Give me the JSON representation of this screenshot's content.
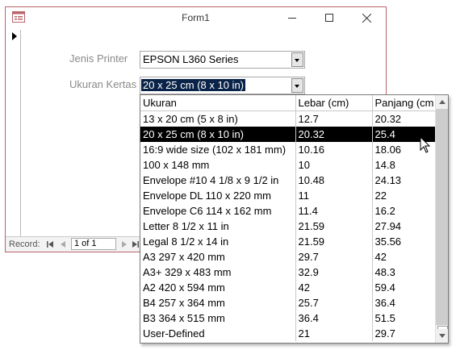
{
  "window": {
    "title": "Form1"
  },
  "form": {
    "printer_label": "Jenis Printer",
    "printer_value": "EPSON L360 Series",
    "paper_label": "Ukuran Kertas",
    "paper_value": "20 x 25 cm (8 x 10 in)"
  },
  "navigation": {
    "record_label": "Record:",
    "record_position": "1 of 1"
  },
  "dropdown": {
    "columns": [
      "Ukuran",
      "Lebar (cm)",
      "Panjang (cm"
    ],
    "selected_index": 1,
    "rows": [
      [
        "13 x 20 cm (5 x 8 in)",
        "12.7",
        "20.32"
      ],
      [
        "20 x 25 cm (8 x 10 in)",
        "20.32",
        "25.4"
      ],
      [
        "16:9 wide size (102 x 181 mm)",
        "10.16",
        "18.06"
      ],
      [
        "100 x 148 mm",
        "10",
        "14.8"
      ],
      [
        "Envelope #10 4 1/8 x 9 1/2 in",
        "10.48",
        "24.13"
      ],
      [
        "Envelope DL  110 x 220 mm",
        "11",
        "22"
      ],
      [
        "Envelope C6  114 x 162 mm",
        "11.4",
        "16.2"
      ],
      [
        "Letter 8 1/2 x 11 in",
        "21.59",
        "27.94"
      ],
      [
        "Legal 8 1/2 x 14 in",
        "21.59",
        "35.56"
      ],
      [
        "A3 297 x 420 mm",
        "29.7",
        "42"
      ],
      [
        "A3+ 329 x 483 mm",
        "32.9",
        "48.3"
      ],
      [
        "A2 420 x 594 mm",
        "42",
        "59.4"
      ],
      [
        "B4 257 x 364 mm",
        "25.7",
        "36.4"
      ],
      [
        "B3 364 x 515 mm",
        "36.4",
        "51.5"
      ],
      [
        "User-Defined",
        "21",
        "29.7"
      ]
    ]
  },
  "colors": {
    "window_border": "#b9646b",
    "selection_bg": "#000000",
    "combo_selection_bg": "#0a2349"
  },
  "icons": [
    "form-icon",
    "minimize-icon",
    "maximize-icon",
    "close-icon",
    "record-selector-icon",
    "first-record-icon",
    "previous-record-icon",
    "next-record-icon",
    "last-record-icon",
    "combo-arrow-icon",
    "mouse-cursor-icon"
  ]
}
